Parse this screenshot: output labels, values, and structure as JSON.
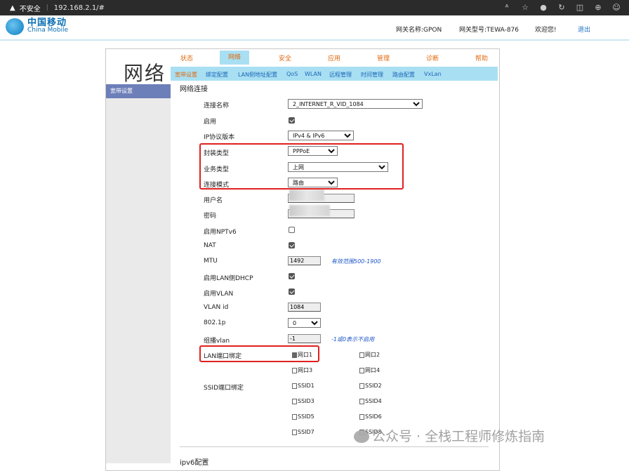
{
  "browser": {
    "security": "不安全",
    "url": "192.168.2.1/#"
  },
  "header": {
    "logo_cn": "中国移动",
    "logo_en": "China Mobile",
    "gateway_name": "网关名称:GPON",
    "gateway_model": "网关型号:TEWA-876",
    "welcome": "欢迎您!",
    "logout": "退出"
  },
  "page_title": "网络",
  "main_nav": [
    "状态",
    "网络",
    "安全",
    "应用",
    "管理",
    "诊断",
    "帮助"
  ],
  "sub_nav": [
    "宽带设置",
    "绑定配置",
    "LAN侧地址配置",
    "QoS",
    "WLAN",
    "远程管理",
    "时间管理",
    "路由配置",
    "VxLan"
  ],
  "sidebar": {
    "active": "宽带设置"
  },
  "section_title": "网络连接",
  "form": {
    "conn_name_label": "连接名称",
    "conn_name_value": "2_INTERNET_R_VID_1084",
    "enable_label": "启用",
    "ip_version_label": "IP协议版本",
    "ip_version_value": "IPv4 & IPv6",
    "encap_label": "封装类型",
    "encap_value": "PPPoE",
    "service_label": "业务类型",
    "service_value": "上网",
    "mode_label": "连接模式",
    "mode_value": "路由",
    "username_label": "用户名",
    "password_label": "密码",
    "nptv6_label": "启用NPTv6",
    "nat_label": "NAT",
    "mtu_label": "MTU",
    "mtu_value": "1492",
    "mtu_hint": "有效范围500-1900",
    "lan_dhcp_label": "启用LAN侧DHCP",
    "vlan_enable_label": "启用VLAN",
    "vlan_id_label": "VLAN id",
    "vlan_id_value": "1084",
    "dot1p_label": "802.1p",
    "dot1p_value": "0",
    "mvlan_label": "组播vlan",
    "mvlan_value": "-1",
    "mvlan_hint": "-1或0表示不启用",
    "lan_bind_label": "LAN端口绑定",
    "ssid_bind_label": "SSID端口绑定",
    "ports": [
      "网口1",
      "网口2",
      "网口3",
      "网口4"
    ],
    "ssids": [
      "SSID1",
      "SSID2",
      "SSID3",
      "SSID4",
      "SSID5",
      "SSID6",
      "SSID7",
      "SSID8"
    ],
    "ipv6_title": "ipv6配置"
  },
  "watermark": "公众号 · 全栈工程师修炼指南"
}
